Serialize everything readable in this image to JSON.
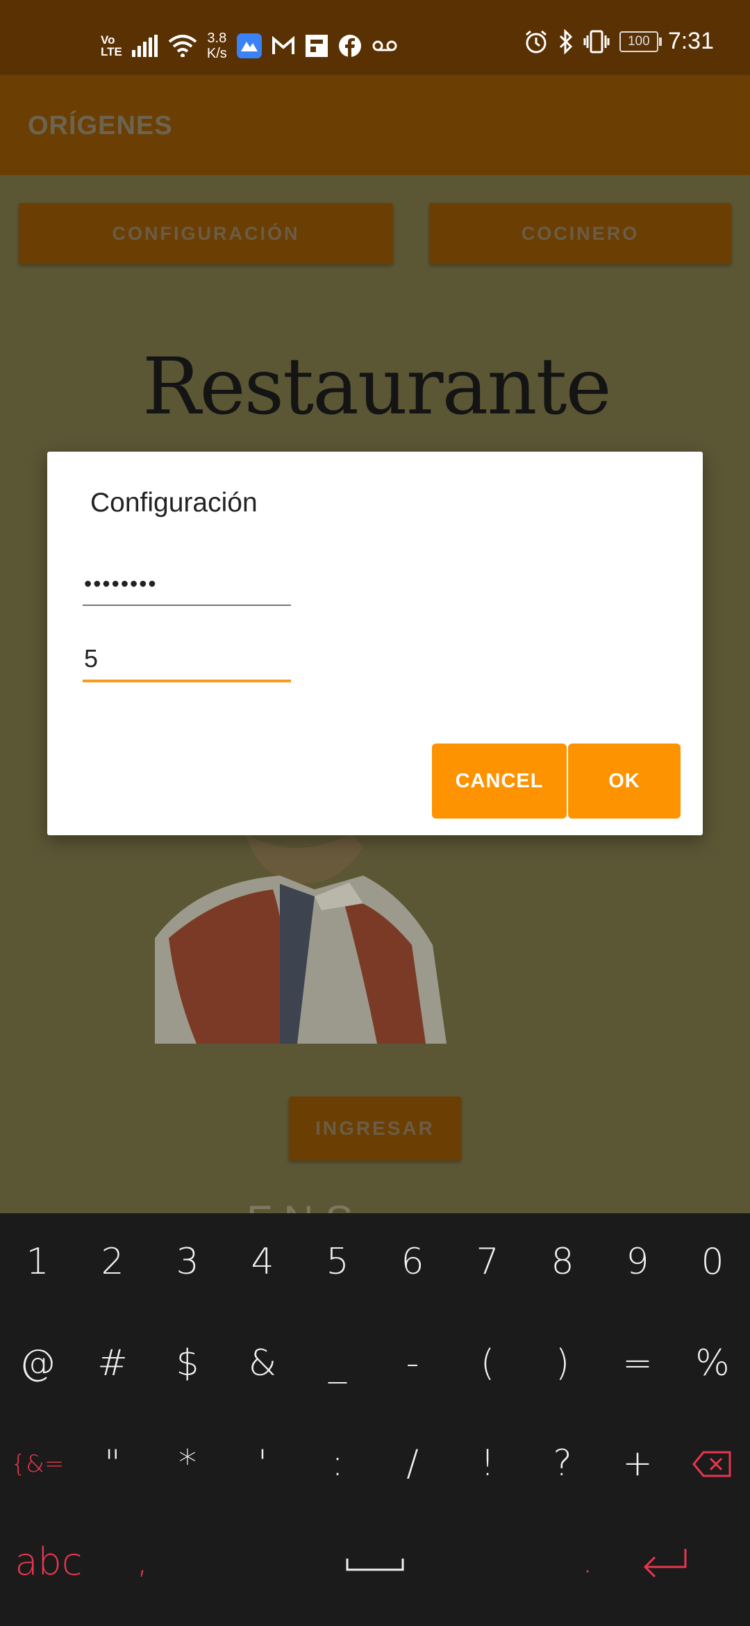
{
  "status_bar": {
    "volte_top": "Vo",
    "volte_bottom": "LTE",
    "speed_value": "3.8",
    "speed_unit": "K/s",
    "battery": "100",
    "time": "7:31"
  },
  "app_bar": {
    "title": "ORÍGENES"
  },
  "main": {
    "config_button": "CONFIGURACIÓN",
    "cook_button": "COCINERO",
    "logo_text": "Restaurante",
    "enter_button": "INGRESAR",
    "peek_text": "F   N   S"
  },
  "dialog": {
    "title": "Configuración",
    "password_value": "••••••••",
    "number_value": "5",
    "cancel_label": "CANCEL",
    "ok_label": "OK"
  },
  "keyboard": {
    "row1": [
      "1",
      "2",
      "3",
      "4",
      "5",
      "6",
      "7",
      "8",
      "9",
      "0"
    ],
    "row2": [
      "@",
      "#",
      "$",
      "&",
      "_",
      "-",
      "(",
      ")",
      "=",
      "%"
    ],
    "row3": [
      "{&=",
      "\"",
      "*",
      "'",
      ":",
      "/",
      "!",
      "?",
      "+"
    ],
    "row4_abc": "abc",
    "row4_comma": ",",
    "row4_period": "."
  },
  "colors": {
    "status_bar": "#5a3103",
    "app_bar": "#6b3f04",
    "dialog_button": "#fd9300",
    "field_accent": "#fb9a1c",
    "keyboard_bg": "#1b1b1b",
    "keyboard_accent": "#e8364e"
  }
}
